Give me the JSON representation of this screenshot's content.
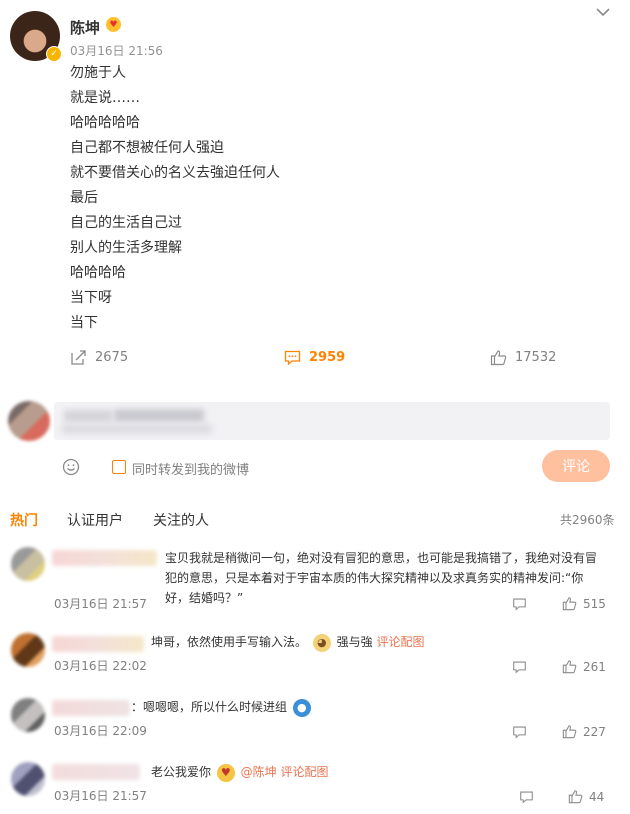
{
  "post": {
    "username": "陈坤",
    "time": "03月16日 21:56",
    "lines": [
      "勿施于人",
      "就是说……",
      "哈哈哈哈哈",
      "自己都不想被任何人强迫",
      "就不要借关心的名义去強迫任何人",
      "最后",
      "自己的生活自己过",
      "别人的生活多理解",
      "哈哈哈哈",
      "当下呀",
      "当下"
    ],
    "repost_count": "2675",
    "comment_count": "2959",
    "like_count": "17532",
    "accent_color": "#ff8200"
  },
  "compose": {
    "repost_label": "同时转发到我的微博",
    "submit_label": "评论"
  },
  "tabs": [
    "热门",
    "认证用户",
    "关注的人"
  ],
  "total_label": "共2960条",
  "comments": [
    {
      "text": "宝贝我就是稍微问一句，绝对没有冒犯的意思，也可能是我搞错了，我绝对没有冒犯的意思，只是本着对于宇宙本质的伟大探究精神以及求真务实的精神发问:“你好，结婚吗？”",
      "time": "03月16日 21:57",
      "likes": "515"
    },
    {
      "text": "坤哥，依然使用手写输入法。",
      "emoji_icon": "doge-icon",
      "tail": "强与強",
      "link": "评论配图",
      "time": "03月16日 22:02",
      "likes": "261"
    },
    {
      "text": "：嗯嗯嗯，所以什么时候进组",
      "emoji_icon": "doraemon-icon",
      "time": "03月16日 22:09",
      "likes": "227"
    },
    {
      "text": "老公我爱你",
      "emoji_icon": "kiss-face-icon",
      "mention": "@陈坤",
      "link": "评论配图",
      "time": "03月16日 21:57",
      "likes": "44"
    }
  ]
}
